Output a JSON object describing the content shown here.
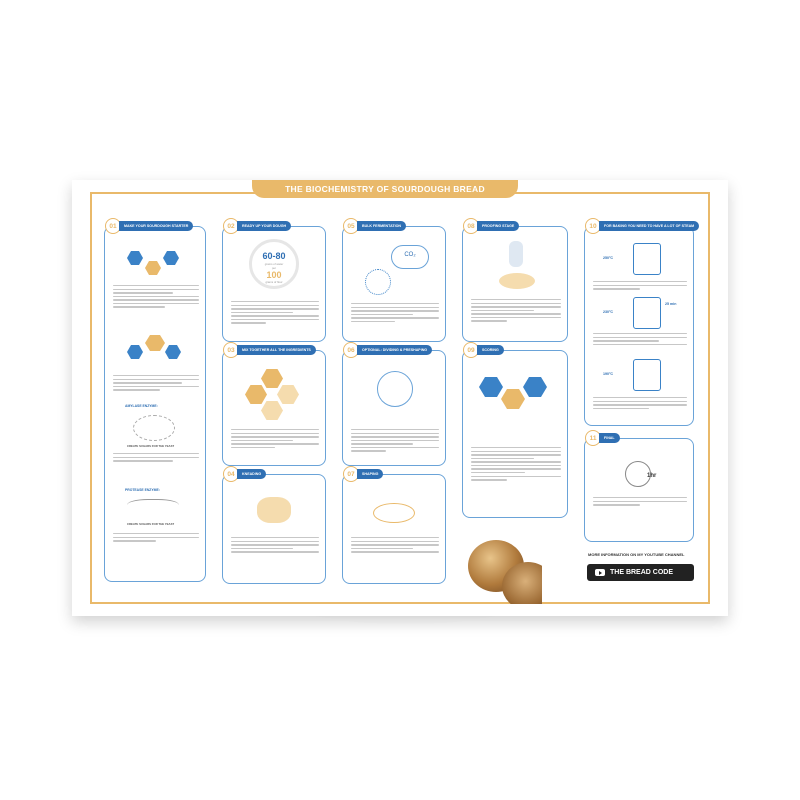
{
  "poster": {
    "title": "THE BIOCHEMISTRY OF SOURDOUGH BREAD",
    "sections": [
      {
        "num": "01",
        "title": "MAKE YOUR SOURDOUGH STARTER"
      },
      {
        "num": "02",
        "title": "READY UP YOUR DOUGH"
      },
      {
        "num": "03",
        "title": "MIX TOGETHER ALL THE INGREDIENTS"
      },
      {
        "num": "04",
        "title": "KNEADING"
      },
      {
        "num": "05",
        "title": "BULK FERMENTATION"
      },
      {
        "num": "06",
        "title": "OPTIONAL: DIVIDING & PRESHAPING"
      },
      {
        "num": "07",
        "title": "SHAPING"
      },
      {
        "num": "08",
        "title": "PROOFING STAGE"
      },
      {
        "num": "09",
        "title": "SCORING"
      },
      {
        "num": "10",
        "title": "FOR BAKING YOU NEED TO HAVE A LOT OF STEAM"
      },
      {
        "num": "11",
        "title": "FINAL"
      }
    ],
    "dough_ratio": {
      "top": "60-80",
      "top_unit": "grams of water",
      "per": "per",
      "bottom": "100",
      "bottom_unit": "grams of flour"
    },
    "enzymes": {
      "amylase": "AMYLASE ENZYME:",
      "amylase_result": "CREATE SUGARS FOR THE YEAST",
      "protease": "PROTEASE ENZYME:",
      "protease_result": "CREATE SUGARS FOR THE YEAST"
    },
    "co2": "CO₂",
    "temps": [
      "250°C",
      "230°C",
      "190°C"
    ],
    "timer": "25 min",
    "clock": "1hr",
    "youtube_note": "MORE INFORMATION ON MY YOUTUBE CHANNEL",
    "youtube_button": "THE BREAD CODE"
  },
  "colors": {
    "gold": "#e9b96a",
    "blue": "#2f6fb3",
    "light_blue": "#6aa3d8"
  }
}
